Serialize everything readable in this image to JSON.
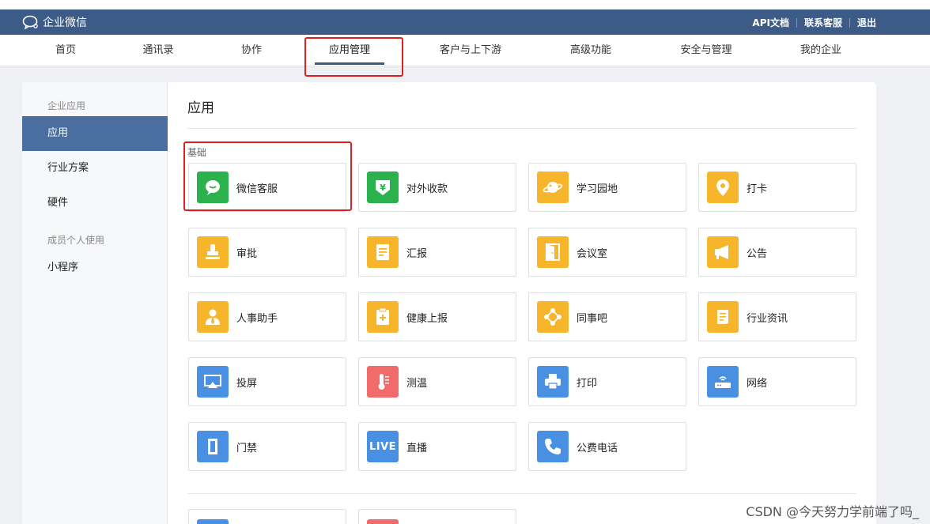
{
  "header": {
    "logo_text": "企业微信",
    "links": [
      "API文档",
      "联系客服",
      "退出"
    ]
  },
  "nav": {
    "items": [
      "首页",
      "通讯录",
      "协作",
      "应用管理",
      "客户与上下游",
      "高级功能",
      "安全与管理",
      "我的企业"
    ],
    "active": "应用管理"
  },
  "sidebar": {
    "group1": "企业应用",
    "items1": [
      "应用",
      "行业方案",
      "硬件"
    ],
    "group2": "成员个人使用",
    "items2": [
      "小程序"
    ],
    "active": "应用"
  },
  "content": {
    "title": "应用",
    "section": "基础",
    "apps": [
      {
        "label": "微信客服",
        "icon": "chat-bubble-icon",
        "color": "#2bb24c"
      },
      {
        "label": "对外收款",
        "icon": "yuan-shield-icon",
        "color": "#2bb24c"
      },
      {
        "label": "学习园地",
        "icon": "planet-icon",
        "color": "#f7b52c"
      },
      {
        "label": "打卡",
        "icon": "location-pin-icon",
        "color": "#f7b52c"
      },
      {
        "label": "审批",
        "icon": "stamp-icon",
        "color": "#f7b52c"
      },
      {
        "label": "汇报",
        "icon": "report-doc-icon",
        "color": "#f7b52c"
      },
      {
        "label": "会议室",
        "icon": "door-icon",
        "color": "#f7b52c"
      },
      {
        "label": "公告",
        "icon": "megaphone-icon",
        "color": "#f7b52c"
      },
      {
        "label": "人事助手",
        "icon": "person-tie-icon",
        "color": "#f7b52c"
      },
      {
        "label": "健康上报",
        "icon": "health-clipboard-icon",
        "color": "#f7b52c"
      },
      {
        "label": "同事吧",
        "icon": "network-nodes-icon",
        "color": "#f7b52c"
      },
      {
        "label": "行业资讯",
        "icon": "scroll-icon",
        "color": "#f7b52c"
      },
      {
        "label": "投屏",
        "icon": "screen-cast-icon",
        "color": "#4a90e2"
      },
      {
        "label": "测温",
        "icon": "thermometer-icon",
        "color": "#f26b6b"
      },
      {
        "label": "打印",
        "icon": "printer-icon",
        "color": "#4a90e2"
      },
      {
        "label": "网络",
        "icon": "router-icon",
        "color": "#4a90e2"
      },
      {
        "label": "门禁",
        "icon": "access-door-icon",
        "color": "#4a90e2"
      },
      {
        "label": "直播",
        "icon": "live-badge-icon",
        "color": "#4a90e2",
        "badge": "LIVE"
      },
      {
        "label": "公费电话",
        "icon": "phone-icon",
        "color": "#4a90e2"
      }
    ]
  },
  "watermark": "CSDN @今天努力学前端了吗_",
  "colors": {
    "topbar": "#3d5b87",
    "sidebar_active": "#4a6ea0",
    "green": "#2bb24c",
    "yellow": "#f7b52c",
    "blue": "#4a90e2",
    "red": "#f26b6b",
    "highlight": "#e02020"
  }
}
